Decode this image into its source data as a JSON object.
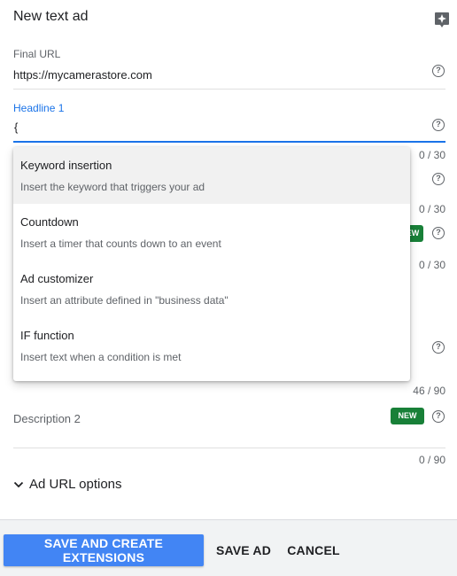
{
  "header": {
    "title": "New text ad",
    "ai_icon": "sparkle-icon"
  },
  "final_url": {
    "label": "Final URL",
    "value": "https://mycamerastore.com"
  },
  "headline1": {
    "label": "Headline 1",
    "value": "{",
    "counter": "0 / 30"
  },
  "hidden_rows": {
    "headline2_counter": "0 / 30",
    "headline3_counter": "0 / 30",
    "description1_counter": "46 / 90"
  },
  "badges": {
    "new_label": "NEW",
    "new_partial_label": "EW",
    "color": "#188038"
  },
  "dropdown": {
    "items": [
      {
        "title": "Keyword insertion",
        "description": "Insert the keyword that triggers your ad"
      },
      {
        "title": "Countdown",
        "description": "Insert a timer that counts down to an event"
      },
      {
        "title": "Ad customizer",
        "description": "Insert an attribute defined in \"business data\""
      },
      {
        "title": "IF function",
        "description": "Insert text when a condition is met"
      }
    ]
  },
  "description2": {
    "label": "Description 2",
    "counter": "0 / 90"
  },
  "ad_url_options": {
    "label": "Ad URL options",
    "icon": "chevron-down-icon"
  },
  "footer": {
    "save_create_label": "SAVE AND CREATE EXTENSIONS",
    "save_ad_label": "SAVE AD",
    "cancel_label": "CANCEL",
    "primary_color": "#4285f4"
  },
  "help_icon_glyph": "?",
  "colors": {
    "focus": "#1a73e8"
  }
}
